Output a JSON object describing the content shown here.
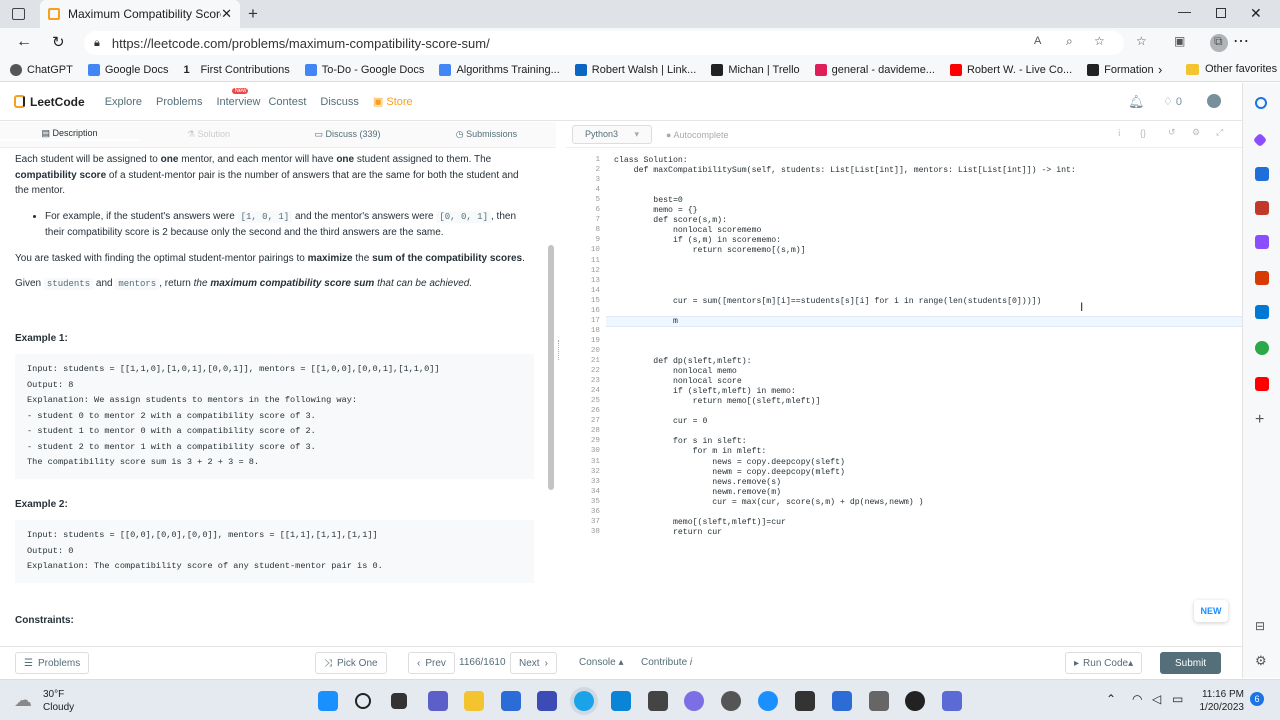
{
  "browser": {
    "tab_title": "Maximum Compatibility Score Su",
    "url": "https://leetcode.com/problems/maximum-compatibility-score-sum/",
    "bookmarks": [
      "ChatGPT",
      "Google Docs",
      "First Contributions",
      "To-Do - Google Docs",
      "Algorithms Training...",
      "Robert Walsh | Link...",
      "Michan | Trello",
      "general - davideme...",
      "Robert W. - Live Co...",
      "Formation"
    ],
    "other_favorites": "Other favorites"
  },
  "nav": {
    "logo": "LeetCode",
    "items": [
      "Explore",
      "Problems",
      "Interview",
      "Contest",
      "Discuss",
      "Store"
    ],
    "new_badge": "New",
    "coins": "0"
  },
  "tabs": [
    "Description",
    "Solution",
    "Discuss (339)",
    "Submissions"
  ],
  "desc": {
    "p1a": "Each student will be assigned to ",
    "p1b": "one",
    "p1c": " mentor, and each mentor will have ",
    "p1d": "one",
    "p1e": " student assigned to them. The ",
    "p1f": "compatibility score",
    "p1g": " of a student-mentor pair is the number of answers that are the same for both the student and the mentor.",
    "bullet_a": "For example, if the student's answers were ",
    "bullet_code1": "[1, 0, 1]",
    "bullet_b": " and the mentor's answers were ",
    "bullet_code2": "[0, 0, 1]",
    "bullet_c": ", then their compatibility score is 2 because only the second and the third answers are the same.",
    "p2a": "You are tasked with finding the optimal student-mentor pairings to ",
    "p2b": "maximize",
    "p2c": " the ",
    "p2d": "sum of the compatibility scores",
    "p2e": ".",
    "p3a": "Given ",
    "p3b": "students",
    "p3c": " and ",
    "p3d": "mentors",
    "p3e": ", return ",
    "p3f": "the ",
    "p3g": "maximum compatibility score sum",
    "p3h": " that can be achieved.",
    "ex1_title": "Example 1:",
    "ex1": "Input: students = [[1,1,0],[1,0,1],[0,0,1]], mentors = [[1,0,0],[0,0,1],[1,1,0]]\nOutput: 8\nExplanation: We assign students to mentors in the following way:\n- student 0 to mentor 2 with a compatibility score of 3.\n- student 1 to mentor 0 with a compatibility score of 2.\n- student 2 to mentor 1 with a compatibility score of 3.\nThe compatibility score sum is 3 + 2 + 3 = 8.",
    "ex2_title": "Example 2:",
    "ex2": "Input: students = [[0,0],[0,0],[0,0]], mentors = [[1,1],[1,1],[1,1]]\nOutput: 0\nExplanation: The compatibility score of any student-mentor pair is 0.",
    "constraints": "Constraints:"
  },
  "editor": {
    "language": "Python3",
    "autocomplete": "Autocomplete",
    "lines": [
      "class Solution:",
      "    def maxCompatibilitySum(self, students: List[List[int]], mentors: List[List[int]]) -> int:",
      "",
      "",
      "        best=0",
      "        memo = {}",
      "        def score(s,m):",
      "            nonlocal scorememo",
      "            if (s,m) in scorememo:",
      "                return scorememo[(s,m)]",
      "",
      "",
      "",
      "",
      "            cur = sum([mentors[m][i]==students[s][i] for i in range(len(students[0]))])",
      "",
      "            m",
      "",
      "",
      "",
      "        def dp(sleft,mleft):",
      "            nonlocal memo",
      "            nonlocal score",
      "            if (sleft,mleft) in memo:",
      "                return memo[(sleft,mleft)]",
      "",
      "            cur = 0",
      "",
      "            for s in sleft:",
      "                for m in mleft:",
      "                    news = copy.deepcopy(sleft)",
      "                    newm = copy.deepcopy(mleft)",
      "                    news.remove(s)",
      "                    newm.remove(m)",
      "                    cur = max(cur, score(s,m) + dp(news,newm) )",
      "",
      "            memo[(sleft,mleft)]=cur",
      "            return cur"
    ]
  },
  "bottom": {
    "problems": "Problems",
    "pick_one": "Pick One",
    "prev": "Prev",
    "counter": "1166/1610",
    "next": "Next",
    "console": "Console",
    "contribute": "Contribute",
    "run": "Run Code",
    "submit": "Submit",
    "new": "NEW"
  },
  "taskbar": {
    "temp": "30°F",
    "weather": "Cloudy",
    "time": "11:16 PM",
    "date": "1/20/2023",
    "notif": "6"
  }
}
